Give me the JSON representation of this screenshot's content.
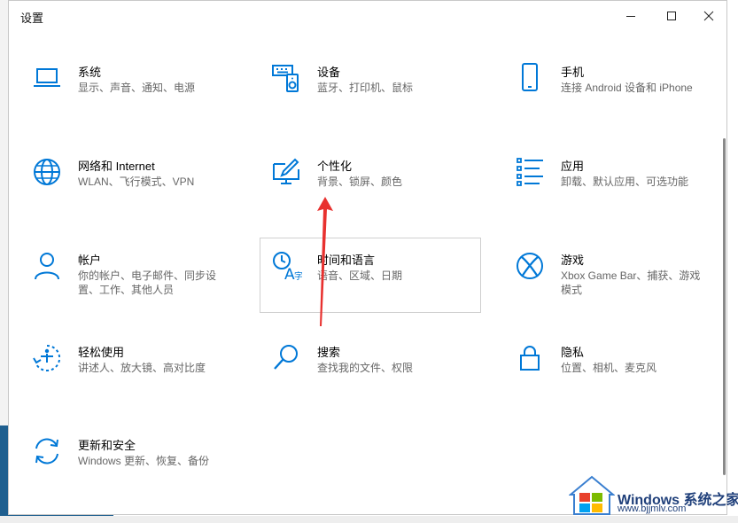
{
  "window": {
    "title": "设置"
  },
  "tiles": [
    {
      "name": "系统",
      "desc": "显示、声音、通知、电源",
      "icon": "laptop-icon"
    },
    {
      "name": "设备",
      "desc": "蓝牙、打印机、鼠标",
      "icon": "keyboard-speaker-icon"
    },
    {
      "name": "手机",
      "desc": "连接 Android 设备和 iPhone",
      "icon": "phone-icon"
    },
    {
      "name": "网络和 Internet",
      "desc": "WLAN、飞行模式、VPN",
      "icon": "globe-icon"
    },
    {
      "name": "个性化",
      "desc": "背景、锁屏、颜色",
      "icon": "paint-monitor-icon"
    },
    {
      "name": "应用",
      "desc": "卸载、默认应用、可选功能",
      "icon": "apps-list-icon"
    },
    {
      "name": "帐户",
      "desc": "你的帐户、电子邮件、同步设置、工作、其他人员",
      "icon": "person-icon"
    },
    {
      "name": "时间和语言",
      "desc": "语音、区域、日期",
      "icon": "time-language-icon"
    },
    {
      "name": "游戏",
      "desc": "Xbox Game Bar、捕获、游戏模式",
      "icon": "xbox-icon"
    },
    {
      "name": "轻松使用",
      "desc": "讲述人、放大镜、高对比度",
      "icon": "ease-of-access-icon"
    },
    {
      "name": "搜索",
      "desc": "查找我的文件、权限",
      "icon": "search-icon"
    },
    {
      "name": "隐私",
      "desc": "位置、相机、麦克风",
      "icon": "lock-icon"
    },
    {
      "name": "更新和安全",
      "desc": "Windows 更新、恢复、备份",
      "icon": "sync-icon"
    }
  ],
  "colors": {
    "accent": "#0078d7",
    "annotation": "#e8312f"
  },
  "watermark": {
    "word": "Windows 系统之家",
    "site": "www.bjjmlv.com"
  }
}
